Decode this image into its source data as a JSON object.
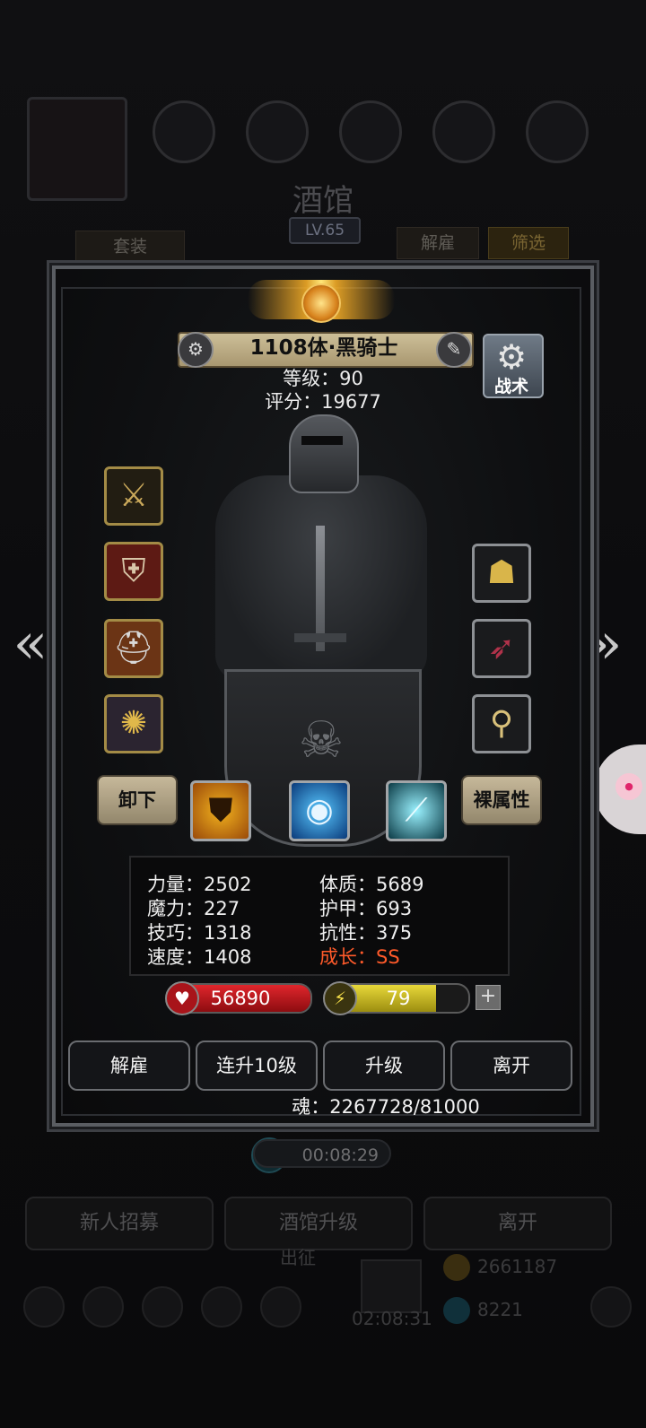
{
  "background": {
    "title": "酒馆",
    "level_badge": "LV.65",
    "set_button": "套装",
    "dismiss_button": "解雇",
    "filter_button": "筛选",
    "timer": "00:08:29",
    "recruit_button": "新人招募",
    "tavern_upgrade_button": "酒馆升级",
    "leave_button": "离开",
    "expedition_label": "出征",
    "gift_timer": "02:08:31",
    "gold_amount": "2661187",
    "gem_amount": "8221"
  },
  "hero": {
    "name": "1108体·黑骑士",
    "level_label": "等级：90",
    "score_label": "评分：19677",
    "tactics_button": "战术"
  },
  "equipment": {
    "left_slots": [
      "sword-icon",
      "armor-icon",
      "helmet-icon",
      "amulet-icon"
    ],
    "right_slots": [
      "shield-charm-icon",
      "bow-icon",
      "magnifier-icon"
    ]
  },
  "skills": {
    "unequip_button": "卸下",
    "base_attr_button": "裸属性",
    "icons": [
      "flame-shield-icon",
      "eye-icon",
      "slash-icon"
    ]
  },
  "attributes": {
    "strength": "力量：2502",
    "magic": "魔力：227",
    "skill": "技巧：1318",
    "speed": "速度：1408",
    "constitution": "体质：5689",
    "armor": "护甲：693",
    "resistance": "抗性：375",
    "growth": "成长：SS"
  },
  "bars": {
    "hp": "56890",
    "energy": "79",
    "energy_fraction": 0.77
  },
  "actions": {
    "dismiss": "解雇",
    "level_up_10": "连升10级",
    "level_up": "升级",
    "leave": "离开"
  },
  "soul": "魂：2267728/81000",
  "colors": {
    "gold_border": "#a38b46",
    "hp_red": "#c4161c",
    "energy_yellow": "#d8c81c",
    "growth_orange": "#ff5a2a"
  }
}
